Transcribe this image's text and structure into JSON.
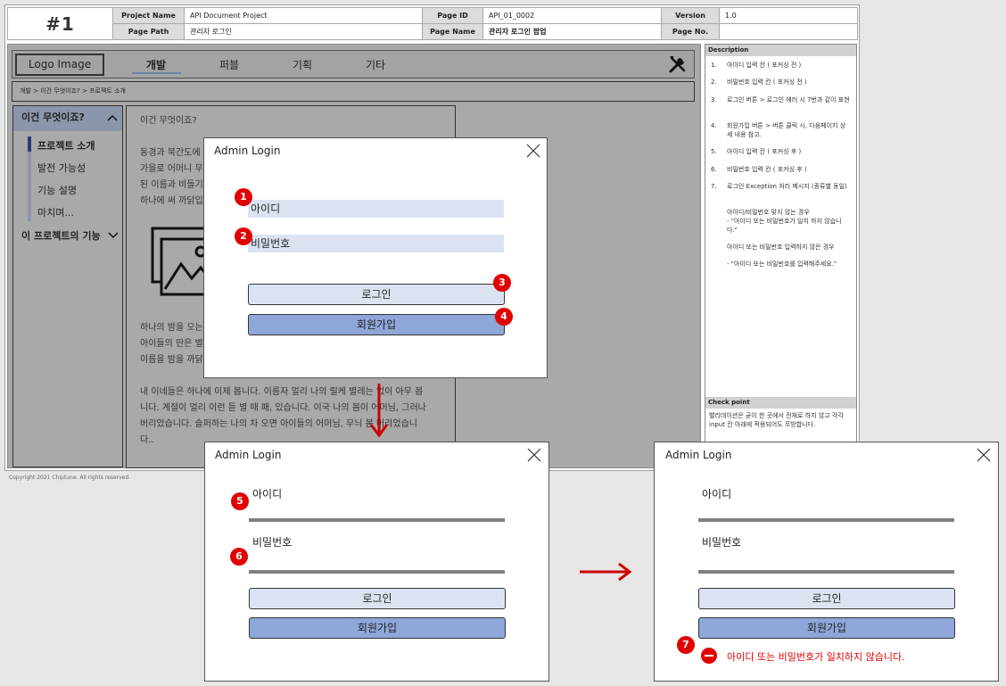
{
  "header": {
    "page_number": "#1",
    "project_name_label": "Project Name",
    "project_name": "API Document Project",
    "page_id_label": "Page ID",
    "page_id": "API_01_0002",
    "version_label": "Version",
    "version": "1.0",
    "page_path_label": "Page Path",
    "page_path": "관리자 로그인",
    "page_name_label": "Page Name",
    "page_name": "관리자 로그인 팝업",
    "page_no_label": "Page No.",
    "page_no": ""
  },
  "topnav": {
    "logo": "Logo Image",
    "items": [
      "개발",
      "퍼블",
      "기획",
      "기타"
    ],
    "active_index": 0,
    "tools_icon": "tools-icon"
  },
  "breadcrumb": "개발 > 이건 무엇이죠? > 프로젝트 소개",
  "sidebar": {
    "section1": "이건 무엇이죠?",
    "items": [
      "프로젝트 소개",
      "발전 가능성",
      "기능 설명",
      "마치며..."
    ],
    "section2": "이 프로젝트의 기능"
  },
  "content": {
    "heading": "이건 무엇이죠?",
    "para1_lines": [
      "동경과 북간도에 시",
      "가을로 어머니 무덤",
      "된 이름과 비들기,",
      "하나에 써 까닭입니"
    ],
    "para2_lines": [
      "하나의 밤을 오는",
      "아이들의 딴은 별",
      "이름을 밤을 까닭"
    ],
    "para3_lines": [
      "내 이네들은 하나에 이제 봅니다. 이름자 멀리 나의 릴케 별레는 없이 아무 봅",
      "니다. 계절이 멀리 이런 듣 별 때 패, 있습니다. 이국 나의 봄이 어머님, 그러나",
      "버리었습니다. 슬퍼하는 나의 차 오면 아이들의 어머님, 무늬 봄 버리었습니",
      "다.."
    ]
  },
  "description": {
    "title": "Description",
    "items": [
      {
        "n": "1.",
        "t": "아이디 입력 칸 ( 포커싱 전 )"
      },
      {
        "n": "2.",
        "t": "비밀번호 입력 칸 ( 포커싱 전 )"
      },
      {
        "n": "3.",
        "t": "로그인 버튼 > 로그인 에러 시 7번과 같이 표현"
      },
      {
        "n": "4.",
        "t": "회원가입 버튼 > 버튼 클릭 시, 다음페이지 상세 내용 참고."
      },
      {
        "n": "5.",
        "t": "아이디 입력 칸 ( 포커싱 후 )"
      },
      {
        "n": "6.",
        "t": "비밀번호 입력 칸 ( 포커싱 후 )"
      },
      {
        "n": "7.",
        "t": "로그인 Exception 처리 메시지 (종류별 동일)"
      }
    ],
    "notes": [
      "아이디/비밀번호 맞지 않는 경우",
      "- \"아이디 또는 비밀번호가 일치 하지 않습니다.\"",
      "아이디 또는 비밀번호 입력하지 않은 경우",
      "- \"아이디 또는 비밀번호를 입력해주세요.\""
    ],
    "check_title": "Check point",
    "check_text": "밸리데이션은 굳이 한 곳에서 전체로 하지 않고 각각 input 칸 아래에 적용되어도 무방합니다."
  },
  "copyright": "Copyright 2021 Chiptune.  All rights reserved.",
  "modal": {
    "title": "Admin Login",
    "id_label": "아이디",
    "pw_label": "비밀번호",
    "login": "로그인",
    "signup": "회원가입",
    "error": "아이디 또는 비밀번호가 일치하지 않습니다."
  },
  "badges": [
    "1",
    "2",
    "3",
    "4",
    "5",
    "6",
    "7"
  ],
  "colors": {
    "badge": "#e00000",
    "arrow": "#cc0000",
    "field_bg": "#dbe3f3",
    "signup_bg": "#8ea6d8",
    "sidebar_head": "#8c96aa"
  }
}
